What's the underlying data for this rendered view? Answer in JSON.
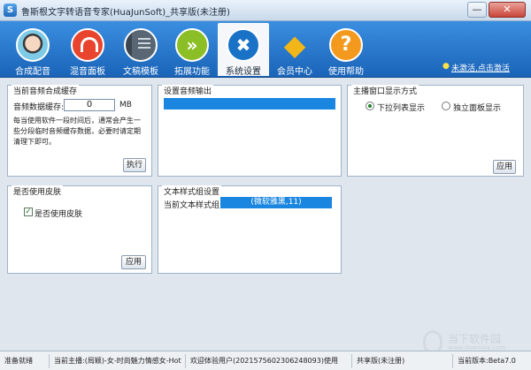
{
  "window": {
    "title": "鲁斯根文字转语音专家(HuaJunSoft)_共享版(未注册)",
    "min_label": "—",
    "close_label": "✕"
  },
  "toolbar": {
    "items": [
      {
        "label": "合成配音",
        "icon": "dubbing-avatar-icon"
      },
      {
        "label": "混音面板",
        "icon": "headphones-icon"
      },
      {
        "label": "文稿模板",
        "icon": "notebook-icon"
      },
      {
        "label": "拓展功能",
        "icon": "double-chevron-icon"
      },
      {
        "label": "系统设置",
        "icon": "wrench-screwdriver-icon"
      },
      {
        "label": "会员中心",
        "icon": "diamond-icon"
      },
      {
        "label": "使用帮助",
        "icon": "question-icon"
      }
    ],
    "activate_label": "未激活,点击激活",
    "ext_glyph": "»",
    "sys_glyph": "✖",
    "vip_glyph": "◆",
    "help_glyph": "?",
    "bulb_glyph": "●"
  },
  "cache_panel": {
    "title": "当前音频合成缓存",
    "label": "音频数据缓存:",
    "value": "0",
    "unit": "MB",
    "desc": "每当使用软件一段时间后，通常会产生一些分段临时音频缓存数据，必要时请定期清理下即可。",
    "button": "执行"
  },
  "audio_panel": {
    "title": "设置音频输出"
  },
  "window_panel": {
    "title": "主播窗口显示方式",
    "options": [
      "下拉列表显示",
      "独立面板显示"
    ],
    "selected": 0,
    "button": "应用"
  },
  "skin_panel": {
    "title": "是否使用皮肤",
    "checkbox_label": "是否使用皮肤",
    "checked": true,
    "check_glyph": "✓",
    "button": "应用"
  },
  "text_style_panel": {
    "title": "文本样式组设置",
    "label": "当前文本样式组:",
    "value": "(微软雅黑,11)"
  },
  "watermark": {
    "text": "当下软件园",
    "sub": "www.downxia.com"
  },
  "statusbar": {
    "segments": [
      "准备就绪",
      "当前主播:(局颖)-女-时尚魅力情感女-Hot",
      "欢迎体验用户(2021575602306248093)使用",
      "共享版(未注册)",
      "当前版本:Beta7.0"
    ]
  },
  "colors": {
    "toolbar_blue": "#1a64b8",
    "highlight_blue": "#1a86e0"
  }
}
